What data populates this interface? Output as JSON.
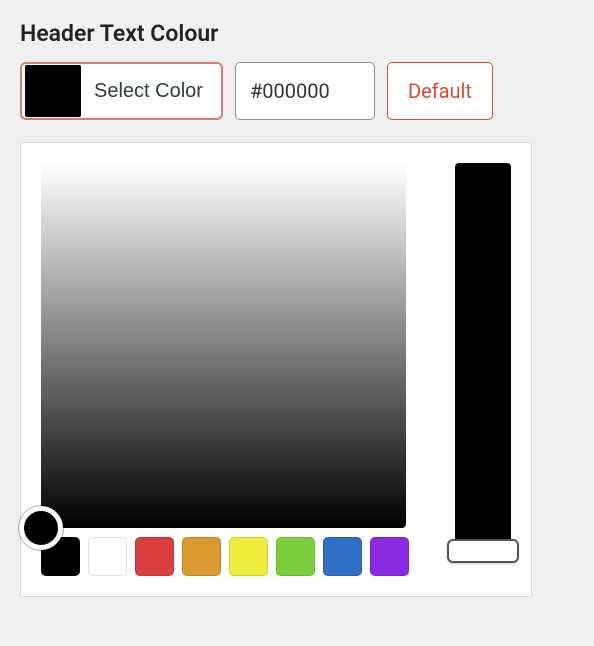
{
  "heading": "Header Text Colour",
  "select_color_label": "Select Color",
  "hex_value": "#000000",
  "default_label": "Default",
  "current_color": "#000000",
  "swatches": [
    {
      "color": "#000000"
    },
    {
      "color": "#ffffff"
    },
    {
      "color": "#d93f3f"
    },
    {
      "color": "#d99b2f"
    },
    {
      "color": "#eded3e"
    },
    {
      "color": "#7bcf3e"
    },
    {
      "color": "#2f6fc4"
    },
    {
      "color": "#8a2be2"
    }
  ]
}
